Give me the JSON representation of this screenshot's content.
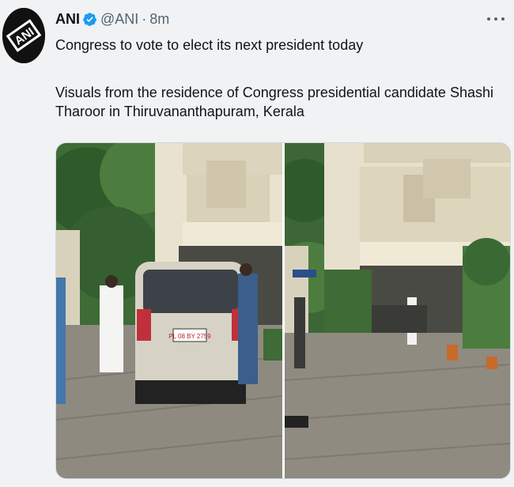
{
  "tweet": {
    "author_name": "ANI",
    "handle": "@ANI",
    "separator": "·",
    "time": "8m",
    "avatar_logo_text": "ANI",
    "text_line1": "Congress to vote to elect its next president today",
    "text_para2": "Visuals from the residence of Congress presidential candidate Shashi Tharoor in Thiruvananthapuram, Kerala"
  },
  "icons": {
    "verified": "verified-badge-icon",
    "more": "more-options-icon"
  },
  "colors": {
    "verified_blue": "#1d9bf0",
    "secondary_text": "#536471"
  },
  "photos": {
    "left_plate_text": "PL 08 BY 2759"
  }
}
